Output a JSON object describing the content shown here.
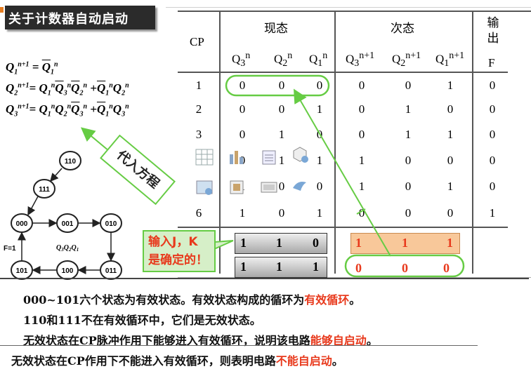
{
  "title": "关于计数器自动启动",
  "equations": {
    "q1": [
      "Q",
      "1",
      "n+1",
      "=",
      "Q",
      "1",
      "n"
    ],
    "q2": "Q2n+1 = Q1n Q3n Q2n + Q1n Q2n",
    "q3": "Q3n+1 = Q1n Q2n Q3n + Q1n Q3n"
  },
  "table": {
    "col_cp": "CP",
    "group_current": "现态",
    "group_next": "次态",
    "group_output": "输出",
    "output_label": "F",
    "current_cols": [
      "Q",
      "Q",
      "Q"
    ],
    "current_subs": [
      "3",
      "2",
      "1"
    ],
    "current_sups": [
      "n",
      "n",
      "n"
    ],
    "next_cols": [
      "Q",
      "Q",
      "Q"
    ],
    "next_subs": [
      "3",
      "2",
      "1"
    ],
    "next_sups": [
      "n+1",
      "n+1",
      "n+1"
    ],
    "rows": [
      {
        "cp": "1",
        "cur": [
          "0",
          "0",
          "0"
        ],
        "next": [
          "0",
          "0",
          "1"
        ],
        "f": "0"
      },
      {
        "cp": "2",
        "cur": [
          "0",
          "0",
          "1"
        ],
        "next": [
          "0",
          "1",
          "0"
        ],
        "f": "0"
      },
      {
        "cp": "3",
        "cur": [
          "0",
          "1",
          "0"
        ],
        "next": [
          "0",
          "1",
          "1"
        ],
        "f": "0"
      },
      {
        "cp": "4",
        "cur": [
          "0",
          "1",
          "1"
        ],
        "next": [
          "1",
          "0",
          "0"
        ],
        "f": "0"
      },
      {
        "cp": "5",
        "cur": [
          "1",
          "0",
          "0"
        ],
        "next": [
          "1",
          "0",
          "1"
        ],
        "f": "0"
      },
      {
        "cp": "6",
        "cur": [
          "1",
          "0",
          "1"
        ],
        "next": [
          "0",
          "0",
          "0"
        ],
        "f": "1"
      }
    ],
    "extra_cur": [
      [
        "1",
        "1",
        "0"
      ],
      [
        "1",
        "1",
        "1"
      ]
    ],
    "extra_next": [
      [
        "1",
        "1",
        "1"
      ],
      [
        "0",
        "0",
        "0"
      ]
    ]
  },
  "diagram": {
    "states": [
      "110",
      "111",
      "000",
      "001",
      "010",
      "011",
      "100",
      "101"
    ],
    "label_f": "F=1",
    "label_q": "Q3Q2Q1"
  },
  "callouts": {
    "substitute": "代入方程",
    "input_line1": "输入J，K",
    "input_line2": "是确定的！"
  },
  "desc": {
    "l1a": "000~101六个状态为有效状态。有效状态构成的循环为",
    "l1b": "有效循环",
    "l1c": "。",
    "l2": "110和111不在有效循环中，它们是无效状态。",
    "l3a": "无效状态在CP脉冲作用下能够进入有效循环，说明该电路",
    "l3b": "能够自启动",
    "l3c": "。",
    "l4a": "无效状态在CP作用下不能进入有效循环，则表明电路",
    "l4b": "不能自启动",
    "l4c": "。"
  },
  "colors": {
    "accent_green": "#66cc44",
    "highlight_red": "#e8391c",
    "orange_fill": "#f8c89a"
  }
}
